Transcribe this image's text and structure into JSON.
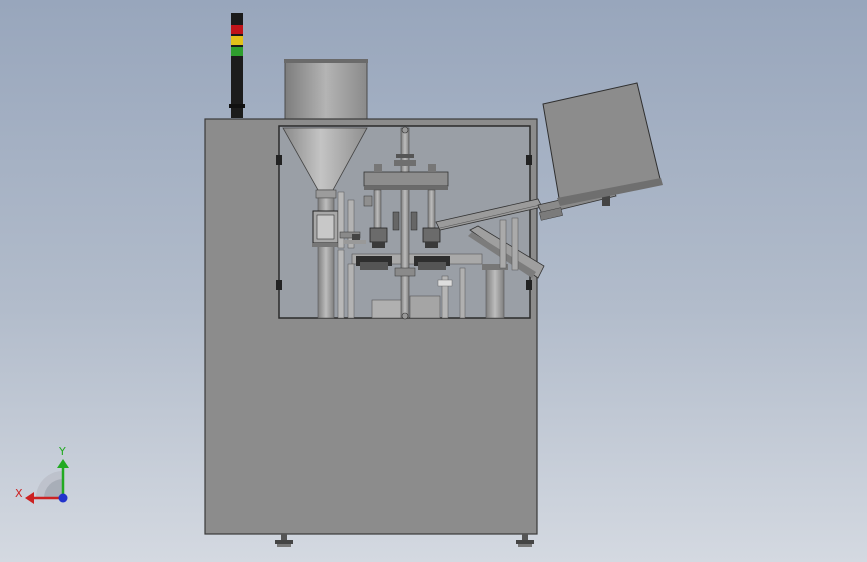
{
  "triad": {
    "x_label": "X",
    "y_label": "Y",
    "x_color": "#cc2222",
    "y_color": "#22aa22",
    "z_color": "#2233cc"
  },
  "colors": {
    "background_top": "#98a6bc",
    "background_bottom": "#d4d9e1",
    "cabinet": "#8c8c8c",
    "cabinet_edge": "#3a3a3a",
    "glass": "#9aa0a8",
    "lamp_red": "#c0141a",
    "lamp_yellow": "#e2c21a",
    "lamp_green": "#2e9e2e"
  },
  "icons": {
    "signal_tower": "signal-tower-icon",
    "hopper": "hopper-icon",
    "conveyor": "tube-feed-icon"
  }
}
